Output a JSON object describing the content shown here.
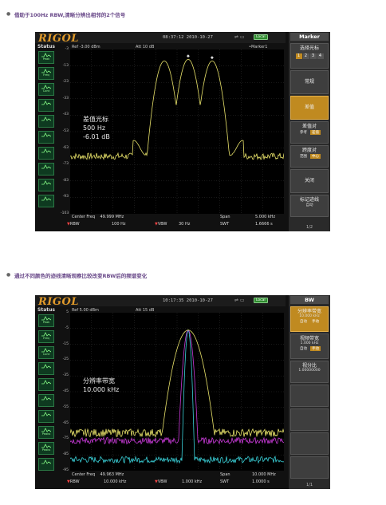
{
  "captions": {
    "first": "借助于100Hz RBW,清晰分辨出相邻的2个信号",
    "second": "通过不同颜色的迹线清晰观察比较改变RBW后的频谱变化"
  },
  "screen1": {
    "logo": "RIGOL",
    "time": "08:37:12 2010-10-27",
    "local": "Local",
    "status": "Status",
    "status_buttons": [
      "Peak",
      "Freq",
      "Cont",
      "",
      "",
      "",
      "",
      "",
      "",
      ""
    ],
    "ref": "Ref -3.00 dBm",
    "att": "Att  10 dB",
    "marker_label": "Marker1",
    "marker_freq": "500 Hz",
    "marker_val": "-6.01 dB",
    "y_ticks": [
      "-3",
      "-13",
      "-23",
      "-33",
      "-43",
      "-53",
      "-63",
      "-73",
      "-83",
      "-93",
      "-103"
    ],
    "overlay": [
      "差值光标",
      "500 Hz",
      "-6.01 dB"
    ],
    "center_label": "Center Freq",
    "center_value": "49.999 MHz",
    "span_label": "Span",
    "span_value": "5.000 kHz",
    "rbw_label": "RBW",
    "rbw_value": "100 Hz",
    "vbw_label": "VBW",
    "vbw_value": "30 Hz",
    "swt_label": "SWT",
    "swt_value": "1.6666 s",
    "menu_title": "Marker",
    "menu_select": "选择光标",
    "menu_numbers": [
      "1",
      "2",
      "3",
      "4"
    ],
    "menu_normal": "常规",
    "menu_delta": "差值",
    "menu_deltapair": "差值对",
    "menu_deltapair_opts": [
      "参考",
      "差值"
    ],
    "menu_span_pair": "跨度对",
    "menu_span_opts": [
      "范围",
      "中心"
    ],
    "menu_off": "关闭",
    "menu_trace": "标记迹线",
    "menu_trace_opt": "自动",
    "page": "1/2",
    "colors": {
      "trace": "#e8e26a"
    }
  },
  "screen2": {
    "logo": "RIGOL",
    "time": "10:17:35 2010-10-27",
    "local": "Local",
    "status": "Status",
    "status_buttons": [
      "Peak",
      "Freq",
      "Cont",
      "",
      "",
      "",
      "",
      "Peaks",
      "Peaks",
      ""
    ],
    "ref": "Ref  5.00 dBm",
    "att": "Att  15 dB",
    "y_ticks": [
      "5",
      "-5",
      "-15",
      "-25",
      "-35",
      "-45",
      "-55",
      "-65",
      "-75",
      "-85",
      "-95"
    ],
    "overlay": [
      "分辨率带宽",
      "10.000 kHz"
    ],
    "center_label": "Center Freq",
    "center_value": "49.963 MHz",
    "span_label": "Span",
    "span_value": "10.000 MHz",
    "rbw_label": "RBW",
    "rbw_value": "10.000 kHz",
    "vbw_label": "VBW",
    "vbw_value": "1.000 kHz",
    "swt_label": "SWT",
    "swt_value": "1.0000 s",
    "menu_title": "BW",
    "menu_rbw": "分辨率带宽",
    "menu_rbw_value": "10.000 kHz",
    "menu_rbw_opts": [
      "自动",
      "手动"
    ],
    "menu_vbw": "视频带宽",
    "menu_vbw_value": "1.000 kHz",
    "menu_vbw_opts": [
      "自动",
      "手动"
    ],
    "menu_ratio": "视分比",
    "menu_ratio_value": "1.00000000",
    "page": "1/1",
    "colors": {
      "trace1": "#e8e26a",
      "trace2": "#c83ad8",
      "trace3": "#3ad0d8"
    }
  }
}
